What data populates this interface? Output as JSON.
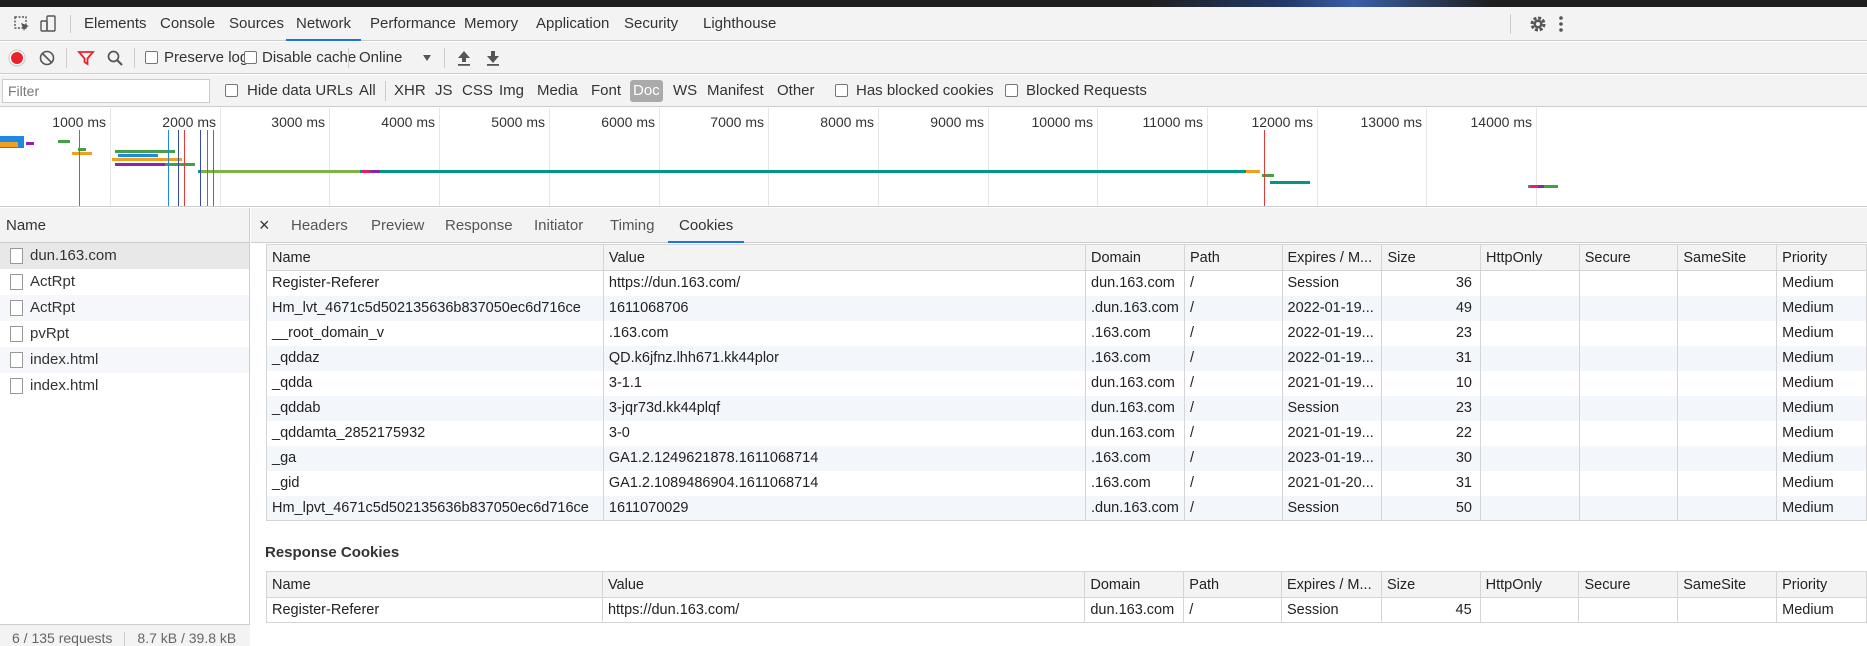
{
  "tabs": {
    "items": [
      "Elements",
      "Console",
      "Sources",
      "Network",
      "Performance",
      "Memory",
      "Application",
      "Security",
      "Lighthouse"
    ],
    "active": "Network"
  },
  "toolbar": {
    "preserve_log": "Preserve log",
    "disable_cache": "Disable cache",
    "throttle": "Online"
  },
  "filterbar": {
    "filter_placeholder": "Filter",
    "hide_data_urls": "Hide data URLs",
    "types": [
      "All",
      "XHR",
      "JS",
      "CSS",
      "Img",
      "Media",
      "Font",
      "Doc",
      "WS",
      "Manifest",
      "Other"
    ],
    "active_type": "Doc",
    "has_blocked_cookies": "Has blocked cookies",
    "blocked_requests": "Blocked Requests"
  },
  "overview": {
    "ticks": [
      "1000 ms",
      "2000 ms",
      "3000 ms",
      "4000 ms",
      "5000 ms",
      "6000 ms",
      "7000 ms",
      "8000 ms",
      "9000 ms",
      "10000 ms",
      "11000 ms",
      "12000 ms",
      "13000 ms",
      "14000 ms"
    ]
  },
  "requests": {
    "header": "Name",
    "items": [
      "dun.163.com",
      "ActRpt",
      "ActRpt",
      "pvRpt",
      "index.html",
      "index.html"
    ],
    "footer_requests": "6 / 135 requests",
    "footer_size": "8.7 kB / 39.8 kB"
  },
  "detail_tabs": {
    "items": [
      "Headers",
      "Preview",
      "Response",
      "Initiator",
      "Timing",
      "Cookies"
    ],
    "active": "Cookies"
  },
  "cookie_columns": [
    "Name",
    "Value",
    "Domain",
    "Path",
    "Expires / M...",
    "Size",
    "HttpOnly",
    "Secure",
    "SameSite",
    "Priority"
  ],
  "request_cookies": [
    [
      "Register-Referer",
      "https://dun.163.com/",
      "dun.163.com",
      "/",
      "Session",
      "36",
      "",
      "",
      "",
      "Medium"
    ],
    [
      "Hm_lvt_4671c5d502135636b837050ec6d716ce",
      "1611068706",
      ".dun.163.com",
      "/",
      "2022-01-19...",
      "49",
      "",
      "",
      "",
      "Medium"
    ],
    [
      "__root_domain_v",
      ".163.com",
      ".163.com",
      "/",
      "2022-01-19...",
      "23",
      "",
      "",
      "",
      "Medium"
    ],
    [
      "_qddaz",
      "QD.k6jfnz.lhh671.kk44plor",
      ".163.com",
      "/",
      "2022-01-19...",
      "31",
      "",
      "",
      "",
      "Medium"
    ],
    [
      "_qdda",
      "3-1.1",
      "dun.163.com",
      "/",
      "2021-01-19...",
      "10",
      "",
      "",
      "",
      "Medium"
    ],
    [
      "_qddab",
      "3-jqr73d.kk44plqf",
      "dun.163.com",
      "/",
      "Session",
      "23",
      "",
      "",
      "",
      "Medium"
    ],
    [
      "_qddamta_2852175932",
      "3-0",
      "dun.163.com",
      "/",
      "2021-01-19...",
      "22",
      "",
      "",
      "",
      "Medium"
    ],
    [
      "_ga",
      "GA1.2.1249621878.1611068714",
      ".163.com",
      "/",
      "2023-01-19...",
      "30",
      "",
      "",
      "",
      "Medium"
    ],
    [
      "_gid",
      "GA1.2.1089486904.1611068714",
      ".163.com",
      "/",
      "2021-01-20...",
      "31",
      "",
      "",
      "",
      "Medium"
    ],
    [
      "Hm_lpvt_4671c5d502135636b837050ec6d716ce",
      "1611070029",
      ".dun.163.com",
      "/",
      "Session",
      "50",
      "",
      "",
      "",
      "Medium"
    ]
  ],
  "response_cookies_title": "Response Cookies",
  "response_cookies": [
    [
      "Register-Referer",
      "https://dun.163.com/",
      "dun.163.com",
      "/",
      "Session",
      "45",
      "",
      "",
      "",
      "Medium"
    ]
  ],
  "colors": {
    "accent": "#1a73e8",
    "record": "#e8232b",
    "filter": "#e8232b"
  }
}
